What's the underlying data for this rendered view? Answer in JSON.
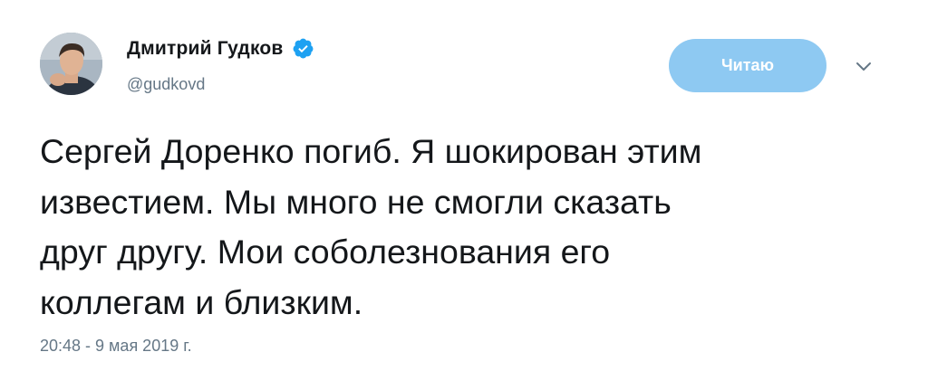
{
  "author": {
    "display_name": "Дмитрий Гудков",
    "handle": "@gudkovd",
    "verified": true
  },
  "follow_button": {
    "label": "Читаю"
  },
  "tweet": {
    "text": "Сергей Доренко погиб. Я шокирован этим\nизвестием. Мы много не смогли сказать\nдруг другу. Мои соболезнования его\nколлегам и близким.",
    "timestamp": "20:48 - 9 мая 2019 г."
  },
  "icons": {
    "verified": "verified-badge-icon",
    "more": "chevron-down-icon"
  },
  "colors": {
    "accent": "#1da1f2",
    "follow_button_bg": "#8ec9f2",
    "secondary_text": "#657786",
    "primary_text": "#14171a"
  }
}
